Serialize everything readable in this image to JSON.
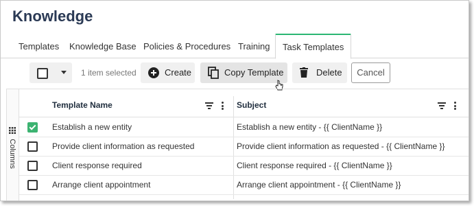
{
  "header": {
    "title": "Knowledge"
  },
  "tabs": [
    {
      "label": "Templates",
      "active": false
    },
    {
      "label": "Knowledge Base",
      "active": false
    },
    {
      "label": "Policies & Procedures",
      "active": false
    },
    {
      "label": "Training",
      "active": false
    },
    {
      "label": "Task Templates",
      "active": true
    }
  ],
  "toolbar": {
    "selection_text": "1 item selected",
    "create_label": "Create",
    "copy_template_label": "Copy Template",
    "delete_label": "Delete",
    "cancel_label": "Cancel"
  },
  "grid": {
    "columns_label": "Columns",
    "headers": [
      "Template Name",
      "Subject"
    ],
    "rows": [
      {
        "checked": true,
        "name": "Establish a new entity",
        "subject": "Establish a new entity - {{ ClientName }}"
      },
      {
        "checked": false,
        "name": "Provide client information as requested",
        "subject": "Provide client information as requested - {{ ClientName }}"
      },
      {
        "checked": false,
        "name": "Client response required",
        "subject": "Client response required - {{ ClientName }}"
      },
      {
        "checked": false,
        "name": "Arrange client appointment",
        "subject": "Arrange client appointment - {{ ClientName }}"
      }
    ]
  },
  "colors": {
    "accent": "#2bb673",
    "checkbox_checked": "#3cb371",
    "title": "#2b3a55"
  }
}
